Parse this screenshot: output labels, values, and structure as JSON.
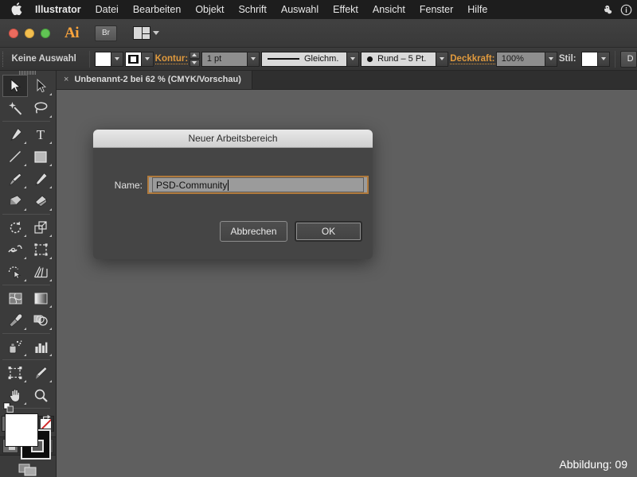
{
  "menubar": {
    "apple_icon": "apple-logo-icon",
    "app_name": "Illustrator",
    "items": [
      "Datei",
      "Bearbeiten",
      "Objekt",
      "Schrift",
      "Auswahl",
      "Effekt",
      "Ansicht",
      "Fenster",
      "Hilfe"
    ],
    "right_icons": [
      "evernote-elephant-icon",
      "info-circle-icon"
    ]
  },
  "titlebar": {
    "app_badge": "Ai",
    "bridge_button": "Br",
    "arrange_documents_icon": "arrange-documents-icon"
  },
  "controlbar": {
    "selection_status": "Keine Auswahl",
    "fill_swatch": "#FFFFFF",
    "stroke_swatch": "#000000",
    "stroke_label": "Kontur:",
    "stroke_weight": "1 pt",
    "profile_label": "Gleichm.",
    "brush_label": "Rund – 5 Pt.",
    "opacity_label": "Deckkraft:",
    "opacity_value": "100%",
    "style_label": "Stil:",
    "style_swatch": "#FFFFFF",
    "document_button": "D"
  },
  "tabbar": {
    "close_glyph": "×",
    "document_tab": "Unbenannt-2 bei 62 % (CMYK/Vorschau)"
  },
  "toolpanel": {
    "tools": [
      {
        "name": "selection-tool",
        "selected": true
      },
      {
        "name": "direct-selection-tool",
        "selected": false
      },
      {
        "name": "magic-wand-tool",
        "selected": false
      },
      {
        "name": "lasso-tool",
        "selected": false
      },
      {
        "name": "pen-tool",
        "selected": false
      },
      {
        "name": "type-tool",
        "selected": false
      },
      {
        "name": "line-segment-tool",
        "selected": false
      },
      {
        "name": "rectangle-tool",
        "selected": false
      },
      {
        "name": "paintbrush-tool",
        "selected": false
      },
      {
        "name": "pencil-tool",
        "selected": false
      },
      {
        "name": "blob-brush-tool",
        "selected": false
      },
      {
        "name": "eraser-tool",
        "selected": false
      },
      {
        "name": "rotate-tool",
        "selected": false
      },
      {
        "name": "scale-tool",
        "selected": false
      },
      {
        "name": "width-tool",
        "selected": false
      },
      {
        "name": "free-transform-tool",
        "selected": false
      },
      {
        "name": "shape-builder-tool",
        "selected": false
      },
      {
        "name": "perspective-grid-tool",
        "selected": false
      },
      {
        "name": "mesh-tool",
        "selected": false
      },
      {
        "name": "gradient-tool",
        "selected": false
      },
      {
        "name": "eyedropper-tool",
        "selected": false
      },
      {
        "name": "blend-tool",
        "selected": false
      },
      {
        "name": "symbol-sprayer-tool",
        "selected": false
      },
      {
        "name": "column-graph-tool",
        "selected": false
      },
      {
        "name": "artboard-tool",
        "selected": false
      },
      {
        "name": "slice-tool",
        "selected": false
      },
      {
        "name": "hand-tool",
        "selected": false
      },
      {
        "name": "zoom-tool",
        "selected": false
      }
    ],
    "fill_color": "#FFFFFF",
    "stroke_color": "#000000",
    "color_modes": [
      "color-swatch-mode",
      "gradient-mode",
      "none-mode"
    ],
    "draw_modes": [
      "draw-normal",
      "draw-behind",
      "draw-inside"
    ],
    "screen_mode": "change-screen-mode"
  },
  "dialog": {
    "title": "Neuer Arbeitsbereich",
    "name_label": "Name:",
    "name_value": "PSD-Community",
    "cancel_button": "Abbrechen",
    "ok_button": "OK"
  },
  "footer": {
    "figure_label": "Abbildung: 09"
  },
  "colors": {
    "canvas": "#5f5f5f",
    "panel": "#3b3b3b",
    "menubar": "#1d1d1d",
    "accent_orange": "#e09a3e",
    "focus_border": "#b07a3c"
  }
}
